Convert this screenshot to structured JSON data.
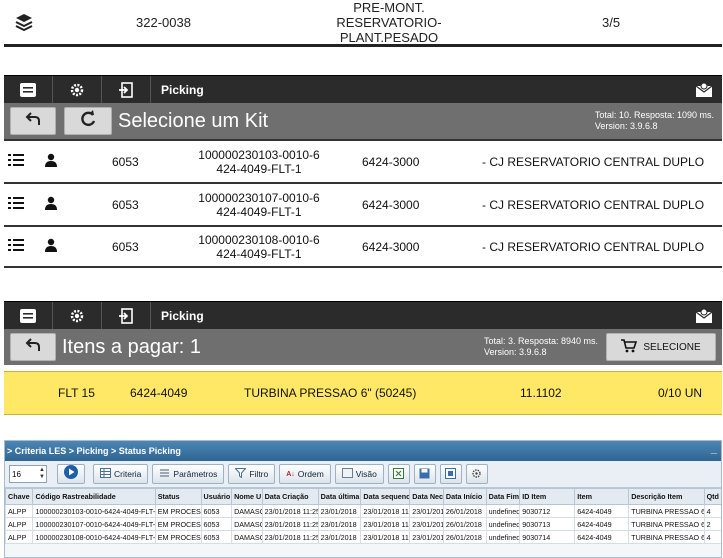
{
  "panel1": {
    "icon": "layers-icon",
    "code": "322-0038",
    "desc_line1": "PRE-MONT. RESERVATORIO-",
    "desc_line2": "PLANT.PESADO",
    "fraction": "3/5"
  },
  "panel2": {
    "header_title": "Picking",
    "heading": "Selecione um Kit",
    "info_line1": "Total: 10. Resposta: 1090 ms.",
    "info_line2": "Version: 3.9.6.8",
    "rows": [
      {
        "num": "6053",
        "code1": "100000230103-0010-6",
        "code2": "424-4049-FLT-1",
        "part": "6424-3000",
        "desc": "- CJ RESERVATORIO CENTRAL DUPLO"
      },
      {
        "num": "6053",
        "code1": "100000230107-0010-6",
        "code2": "424-4049-FLT-1",
        "part": "6424-3000",
        "desc": "- CJ RESERVATORIO CENTRAL DUPLO"
      },
      {
        "num": "6053",
        "code1": "100000230108-0010-6",
        "code2": "424-4049-FLT-1",
        "part": "6424-3000",
        "desc": "- CJ RESERVATORIO CENTRAL DUPLO"
      }
    ]
  },
  "panel3": {
    "header_title": "Picking",
    "heading": "Itens a pagar: 1",
    "info_line1": "Total: 3. Resposta: 8940 ms.",
    "info_line2": "Version: 3.9.6.8",
    "select_label": "SELECIONE",
    "item": {
      "flt": "FLT 15",
      "part": "6424-4049",
      "desc": "TURBINA PRESSAO 6\" (50245)",
      "code": "11.1102",
      "qty": "0/10 UN"
    }
  },
  "panel4": {
    "breadcrumb": "> Criteria LES > Picking > Status Picking",
    "minimize": "_",
    "page_size": "16",
    "buttons": {
      "criteria": "Criteria",
      "parametros": "Parâmetros",
      "filtro": "Filtro",
      "ordem": "Ordem",
      "visao": "Visão"
    },
    "columns": [
      "Chave",
      "Código Rastreabilidade",
      "Status",
      "Usuário",
      "Nome U",
      "Data Criação",
      "Data última",
      "Data sequenc",
      "Data Nec",
      "Data Início",
      "Data Fim",
      "ID Item",
      "Item",
      "Descrição Item",
      "Qtd"
    ],
    "rows": [
      [
        "ALPP",
        "100000230103-0010-6424-4049-FLT-1",
        "EM PROCESSO",
        "6053",
        "DAMASO",
        "23/01/2018 11:25",
        "23/01/2018",
        "23/01/2018 11:",
        "23/01/201",
        "26/01/2018",
        "undefined",
        "9030712",
        "6424-4049",
        "TURBINA PRESSAO 6\" (5",
        "4"
      ],
      [
        "ALPP",
        "100000230107-0010-6424-4049-FLT-1",
        "EM PROCESSO",
        "6053",
        "DAMASO",
        "23/01/2018 11:25",
        "23/01/2018",
        "23/01/2018 11:",
        "23/01/201",
        "26/01/2018",
        "undefined",
        "9030713",
        "6424-4049",
        "TURBINA PRESSAO 6\" (5",
        "2"
      ],
      [
        "ALPP",
        "100000230108-0010-6424-4049-FLT-1",
        "EM PROCESSO",
        "6053",
        "DAMASO",
        "23/01/2018 11:25",
        "23/01/2018",
        "23/01/2018 11:",
        "23/01/201",
        "26/01/2018",
        "undefined",
        "9030714",
        "6424-4049",
        "TURBINA PRESSAO 6\" (5",
        "4"
      ]
    ]
  }
}
